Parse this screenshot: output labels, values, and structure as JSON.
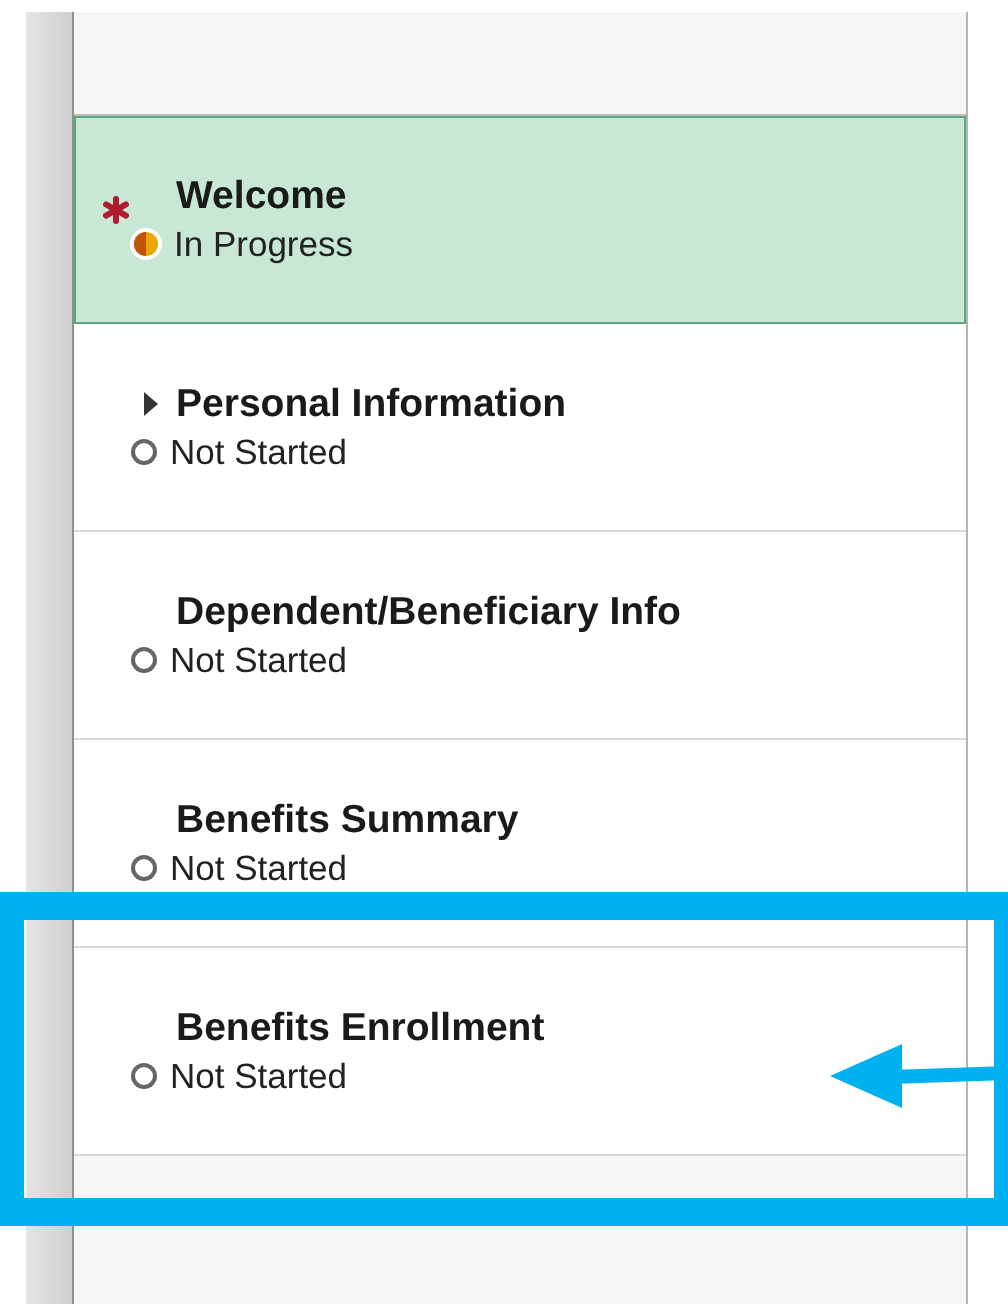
{
  "steps": [
    {
      "title": "Welcome",
      "status": "In Progress",
      "kind": "in_progress",
      "required": true,
      "selected": true,
      "highlighted": false
    },
    {
      "title": "Personal Information",
      "status": "Not Started",
      "kind": "not_started",
      "required": false,
      "selected": false,
      "highlighted": false,
      "expanded": false
    },
    {
      "title": "Dependent/Beneficiary Info",
      "status": "Not Started",
      "kind": "not_started",
      "required": false,
      "selected": false,
      "highlighted": false
    },
    {
      "title": "Benefits Summary",
      "status": "Not Started",
      "kind": "not_started",
      "required": false,
      "selected": false,
      "highlighted": false
    },
    {
      "title": "Benefits Enrollment",
      "status": "Not Started",
      "kind": "not_started",
      "required": false,
      "selected": false,
      "highlighted": true
    }
  ]
}
